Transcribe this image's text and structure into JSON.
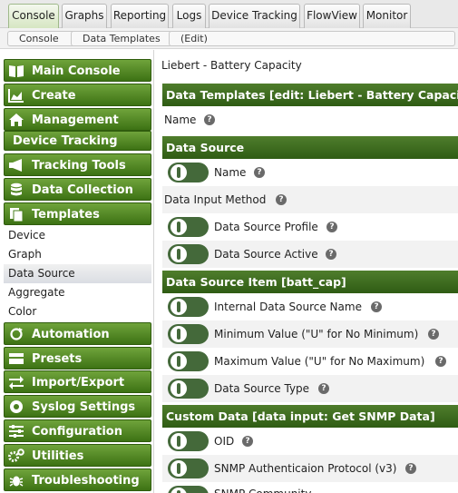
{
  "tabs": [
    "Console",
    "Graphs",
    "Reporting",
    "Logs",
    "Device Tracking",
    "FlowView",
    "Monitor"
  ],
  "breadcrumb": [
    "Console",
    "Data Templates",
    "(Edit)"
  ],
  "sidebar": {
    "menus": [
      {
        "label": "Main Console",
        "icon": "book-icon"
      },
      {
        "label": "Create",
        "icon": "chart-area-icon"
      },
      {
        "label": "Management",
        "icon": "home-icon"
      },
      {
        "label": "Device Tracking",
        "icon": ""
      },
      {
        "label": "Tracking Tools",
        "icon": "megaphone-icon"
      },
      {
        "label": "Data Collection",
        "icon": "database-icon"
      },
      {
        "label": "Templates",
        "icon": "copy-icon"
      }
    ],
    "template_items": [
      "Device",
      "Graph",
      "Data Source",
      "Aggregate",
      "Color"
    ],
    "selected_template_item": "Data Source",
    "menus_bottom": [
      {
        "label": "Automation",
        "icon": "refresh-icon"
      },
      {
        "label": "Presets",
        "icon": "presets-icon"
      },
      {
        "label": "Import/Export",
        "icon": "exchange-icon"
      },
      {
        "label": "Syslog Settings",
        "icon": "lifebuoy-icon"
      },
      {
        "label": "Configuration",
        "icon": "sliders-icon"
      },
      {
        "label": "Utilities",
        "icon": "cogs-icon"
      },
      {
        "label": "Troubleshooting",
        "icon": "bug-icon"
      }
    ]
  },
  "main": {
    "page_title": "Liebert - Battery Capacity",
    "header1": "Data Templates [edit: Liebert - Battery Capacity]",
    "name_label": "Name",
    "header2": "Data Source",
    "ds_name_label": "Name",
    "data_input_method_label": "Data Input Method",
    "ds_profile_label": "Data Source Profile",
    "ds_active_label": "Data Source Active",
    "header3": "Data Source Item [batt_cap]",
    "internal_ds_name_label": "Internal Data Source Name",
    "min_value_label": "Minimum Value (\"U\" for No Minimum)",
    "max_value_label": "Maximum Value (\"U\" for No Maximum)",
    "ds_type_label": "Data Source Type",
    "header4": "Custom Data [data input: Get SNMP Data]",
    "oid_label": "OID",
    "snmp_auth_label": "SNMP Authenticaion Protocol (v3)",
    "snmp_community_label": "SNMP Community"
  },
  "colors": {
    "menu_green": "#4f8a24",
    "header_green": "#3d6a1f",
    "toggle": "#44693a"
  }
}
